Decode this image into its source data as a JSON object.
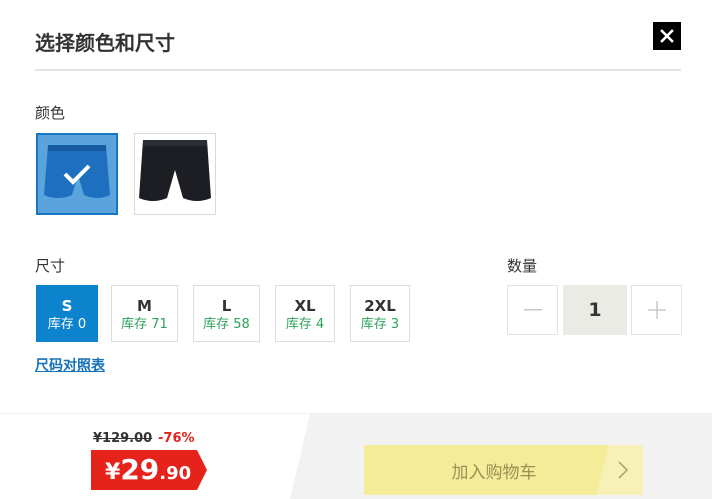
{
  "dialog": {
    "title": "选择颜色和尺寸",
    "close_icon": "close-icon"
  },
  "color": {
    "label": "颜色",
    "options": [
      {
        "name": "blue shorts",
        "color": "#1e6fc0",
        "selected": true
      },
      {
        "name": "black shorts",
        "color": "#1c1e24",
        "selected": false
      }
    ]
  },
  "size": {
    "label": "尺寸",
    "options": [
      {
        "size": "S",
        "stock": "库存 0",
        "selected": true
      },
      {
        "size": "M",
        "stock": "库存 71",
        "selected": false
      },
      {
        "size": "L",
        "stock": "库存 58",
        "selected": false
      },
      {
        "size": "XL",
        "stock": "库存 4",
        "selected": false
      },
      {
        "size": "2XL",
        "stock": "库存 3",
        "selected": false
      }
    ],
    "chart_link": "尺码对照表"
  },
  "quantity": {
    "label": "数量",
    "value": "1",
    "minus_icon": "minus-icon",
    "plus_icon": "plus-icon"
  },
  "price": {
    "original": "¥129.00",
    "discount": "-76%",
    "currency": "¥",
    "integer": "29",
    "decimal": ".90",
    "tag_color": "#e5231b"
  },
  "cart": {
    "label": "加入购物车",
    "button_color": "#f5ec9a",
    "arrow_icon": "chevron-right-icon"
  },
  "colors": {
    "accent": "#0d82cd",
    "stock_green": "#2ca35a",
    "link_blue": "#1672b8"
  }
}
